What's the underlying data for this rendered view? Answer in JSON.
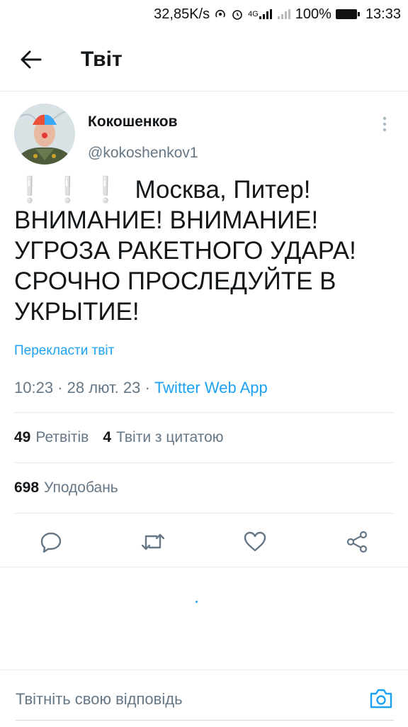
{
  "status_bar": {
    "speed": "32,85K/s",
    "network": "4G",
    "battery": "100%",
    "time": "13:33"
  },
  "header": {
    "title": "Твіт"
  },
  "author": {
    "name": "Кокошенков",
    "handle": "@kokoshenkov1"
  },
  "tweet": {
    "emoji": "❕❕❕",
    "text": "Москва, Питер!\nВНИМАНИЕ! ВНИМАНИЕ!\nУГРОЗА РАКЕТНОГО УДАРА!\nСРОЧНО ПРОСЛЕДУЙТЕ В\nУКРЫТИЕ!",
    "translate_label": "Перекласти твіт",
    "timestamp": "10:23 · 28 лют. 23 · ",
    "source": "Twitter Web App"
  },
  "stats": {
    "retweets_count": "49",
    "retweets_label": "Ретвітів",
    "quotes_count": "4",
    "quotes_label": "Твіти з цитатою",
    "likes_count": "698",
    "likes_label": "Уподобань"
  },
  "reply": {
    "placeholder": "Твітніть свою відповідь"
  },
  "colors": {
    "accent": "#1da1f2",
    "secondary_text": "#657786",
    "divider": "#e6ecf0"
  }
}
